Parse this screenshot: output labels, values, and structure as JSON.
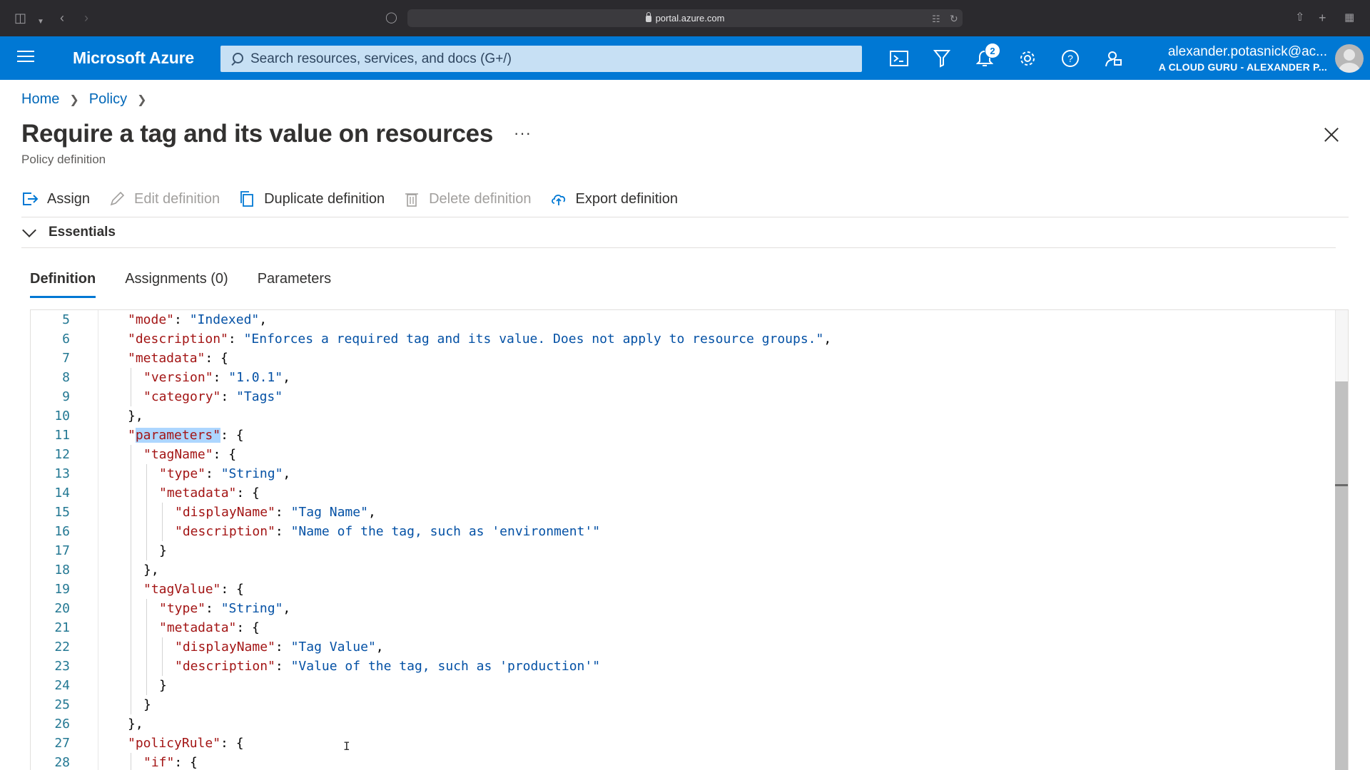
{
  "browser": {
    "url": "portal.azure.com"
  },
  "topbar": {
    "brand": "Microsoft Azure",
    "search_placeholder": "Search resources, services, and docs (G+/)",
    "notification_count": "2",
    "account_name": "alexander.potasnick@ac...",
    "account_directory": "A CLOUD GURU - ALEXANDER P..."
  },
  "breadcrumb": [
    "Home",
    "Policy"
  ],
  "page": {
    "title": "Require a tag and its value on resources",
    "more": "···",
    "subtitle": "Policy definition"
  },
  "commands": {
    "assign": "Assign",
    "edit": "Edit definition",
    "duplicate": "Duplicate definition",
    "delete": "Delete definition",
    "export": "Export definition"
  },
  "essentials": "Essentials",
  "tabs": {
    "definition": "Definition",
    "assignments": "Assignments (0)",
    "parameters": "Parameters"
  },
  "code": {
    "lines": [
      {
        "n": "5",
        "indent": 0,
        "text": [
          [
            "k",
            "\"mode\""
          ],
          [
            "p",
            ": "
          ],
          [
            "s",
            "\"Indexed\""
          ],
          [
            "p",
            ","
          ]
        ]
      },
      {
        "n": "6",
        "indent": 0,
        "text": [
          [
            "k",
            "\"description\""
          ],
          [
            "p",
            ": "
          ],
          [
            "s",
            "\"Enforces a required tag and its value. Does not apply to resource groups.\""
          ],
          [
            "p",
            ","
          ]
        ]
      },
      {
        "n": "7",
        "indent": 0,
        "text": [
          [
            "k",
            "\"metadata\""
          ],
          [
            "p",
            ": {"
          ]
        ]
      },
      {
        "n": "8",
        "indent": 1,
        "text": [
          [
            "k",
            "\"version\""
          ],
          [
            "p",
            ": "
          ],
          [
            "s",
            "\"1.0.1\""
          ],
          [
            "p",
            ","
          ]
        ]
      },
      {
        "n": "9",
        "indent": 1,
        "text": [
          [
            "k",
            "\"category\""
          ],
          [
            "p",
            ": "
          ],
          [
            "s",
            "\"Tags\""
          ]
        ]
      },
      {
        "n": "10",
        "indent": 0,
        "text": [
          [
            "p",
            "},"
          ]
        ]
      },
      {
        "n": "11",
        "indent": 0,
        "text": [
          [
            "k",
            "\""
          ],
          [
            "hl",
            "parameters\""
          ],
          [
            "p",
            ": {"
          ]
        ]
      },
      {
        "n": "12",
        "indent": 1,
        "text": [
          [
            "k",
            "\"tagName\""
          ],
          [
            "p",
            ": {"
          ]
        ]
      },
      {
        "n": "13",
        "indent": 2,
        "text": [
          [
            "k",
            "\"type\""
          ],
          [
            "p",
            ": "
          ],
          [
            "s",
            "\"String\""
          ],
          [
            "p",
            ","
          ]
        ]
      },
      {
        "n": "14",
        "indent": 2,
        "text": [
          [
            "k",
            "\"metadata\""
          ],
          [
            "p",
            ": {"
          ]
        ]
      },
      {
        "n": "15",
        "indent": 3,
        "text": [
          [
            "k",
            "\"displayName\""
          ],
          [
            "p",
            ": "
          ],
          [
            "s",
            "\"Tag Name\""
          ],
          [
            "p",
            ","
          ]
        ]
      },
      {
        "n": "16",
        "indent": 3,
        "text": [
          [
            "k",
            "\"description\""
          ],
          [
            "p",
            ": "
          ],
          [
            "s",
            "\"Name of the tag, such as 'environment'\""
          ]
        ]
      },
      {
        "n": "17",
        "indent": 2,
        "text": [
          [
            "p",
            "}"
          ]
        ]
      },
      {
        "n": "18",
        "indent": 1,
        "text": [
          [
            "p",
            "},"
          ]
        ]
      },
      {
        "n": "19",
        "indent": 1,
        "text": [
          [
            "k",
            "\"tagValue\""
          ],
          [
            "p",
            ": {"
          ]
        ]
      },
      {
        "n": "20",
        "indent": 2,
        "text": [
          [
            "k",
            "\"type\""
          ],
          [
            "p",
            ": "
          ],
          [
            "s",
            "\"String\""
          ],
          [
            "p",
            ","
          ]
        ]
      },
      {
        "n": "21",
        "indent": 2,
        "text": [
          [
            "k",
            "\"metadata\""
          ],
          [
            "p",
            ": {"
          ]
        ]
      },
      {
        "n": "22",
        "indent": 3,
        "text": [
          [
            "k",
            "\"displayName\""
          ],
          [
            "p",
            ": "
          ],
          [
            "s",
            "\"Tag Value\""
          ],
          [
            "p",
            ","
          ]
        ]
      },
      {
        "n": "23",
        "indent": 3,
        "text": [
          [
            "k",
            "\"description\""
          ],
          [
            "p",
            ": "
          ],
          [
            "s",
            "\"Value of the tag, such as 'production'\""
          ]
        ]
      },
      {
        "n": "24",
        "indent": 2,
        "text": [
          [
            "p",
            "}"
          ]
        ]
      },
      {
        "n": "25",
        "indent": 1,
        "text": [
          [
            "p",
            "}"
          ]
        ]
      },
      {
        "n": "26",
        "indent": 0,
        "text": [
          [
            "p",
            "},"
          ]
        ]
      },
      {
        "n": "27",
        "indent": 0,
        "text": [
          [
            "k",
            "\"policyRule\""
          ],
          [
            "p",
            ": {"
          ]
        ]
      },
      {
        "n": "28",
        "indent": 1,
        "text": [
          [
            "k",
            "\"if\""
          ],
          [
            "p",
            ": {"
          ]
        ]
      }
    ]
  },
  "colors": {
    "azure_blue": "#0078d4",
    "json_key": "#a31515",
    "json_string": "#0451a5",
    "line_number": "#237893",
    "selection": "#add6ff"
  }
}
